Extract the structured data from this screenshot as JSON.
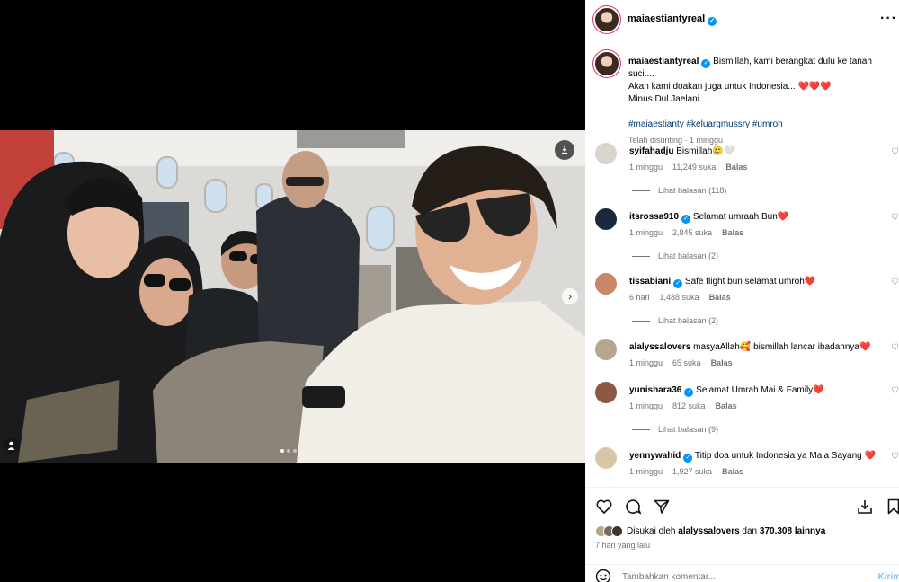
{
  "post": {
    "username": "maiaestiantyreal",
    "more_icon": "more-horizontal-icon"
  },
  "caption": {
    "username": "maiaestiantyreal",
    "text_line1": "Bismillah, kami berangkat dulu ke tanah suci....",
    "text_line2": "Akan kami doakan juga untuk Indonesia... ❤️❤️❤️",
    "text_line3": "Minus Dul Jaelani...",
    "hashtags": "#maiaestianty #keluargmussry #umroh",
    "edited": "Telah disunting · 1 minggu"
  },
  "comments": [
    {
      "user": "syifahadju",
      "verified": false,
      "text": "Bismillah🥲🤍",
      "time": "1 minggu",
      "likes": "11,249 suka",
      "reply": "Balas",
      "replies": "Lihat balasan (118)",
      "avatar_color": "#d9d4ce"
    },
    {
      "user": "itsrossa910",
      "verified": true,
      "text": "Selamat umraah Bun❤️",
      "time": "1 minggu",
      "likes": "2,845 suka",
      "reply": "Balas",
      "replies": "Lihat balasan (2)",
      "avatar_color": "#1b2a3a"
    },
    {
      "user": "tissabiani",
      "verified": true,
      "text": "Safe flight bun selamat umroh❤️",
      "time": "6 hari",
      "likes": "1,488 suka",
      "reply": "Balas",
      "replies": "Lihat balasan (2)",
      "avatar_color": "#c9866a"
    },
    {
      "user": "alalyssalovers",
      "verified": false,
      "text": "masyaAllah🥰 bismillah lancar ibadahnya❤️",
      "time": "1 minggu",
      "likes": "65 suka",
      "reply": "Balas",
      "replies": "",
      "avatar_color": "#b8a58e"
    },
    {
      "user": "yunishara36",
      "verified": true,
      "text": "Selamat Umrah Mai & Family❤️",
      "time": "1 minggu",
      "likes": "812 suka",
      "reply": "Balas",
      "replies": "Lihat balasan (9)",
      "avatar_color": "#8a5a44"
    },
    {
      "user": "yennywahid",
      "verified": true,
      "text": "Titip doa untuk Indonesia ya Maia Sayang ❤️",
      "time": "1 minggu",
      "likes": "1,927 suka",
      "reply": "Balas",
      "replies": "",
      "avatar_color": "#d7c6a8"
    }
  ],
  "likes": {
    "prefix": "Disukai oleh ",
    "user": "alalyssalovers",
    "middle": " dan ",
    "count": "370.308 lainnya"
  },
  "post_time": "7 hari yang lalu",
  "add_comment": {
    "placeholder": "Tambahkan komentar...",
    "submit": "Kirim"
  },
  "colors": {
    "verified": "#0095f6",
    "hashtag": "#00376b",
    "muted": "#737373",
    "heart": "#ed1c3a"
  },
  "carousel": {
    "slides": 3,
    "active": 1
  }
}
